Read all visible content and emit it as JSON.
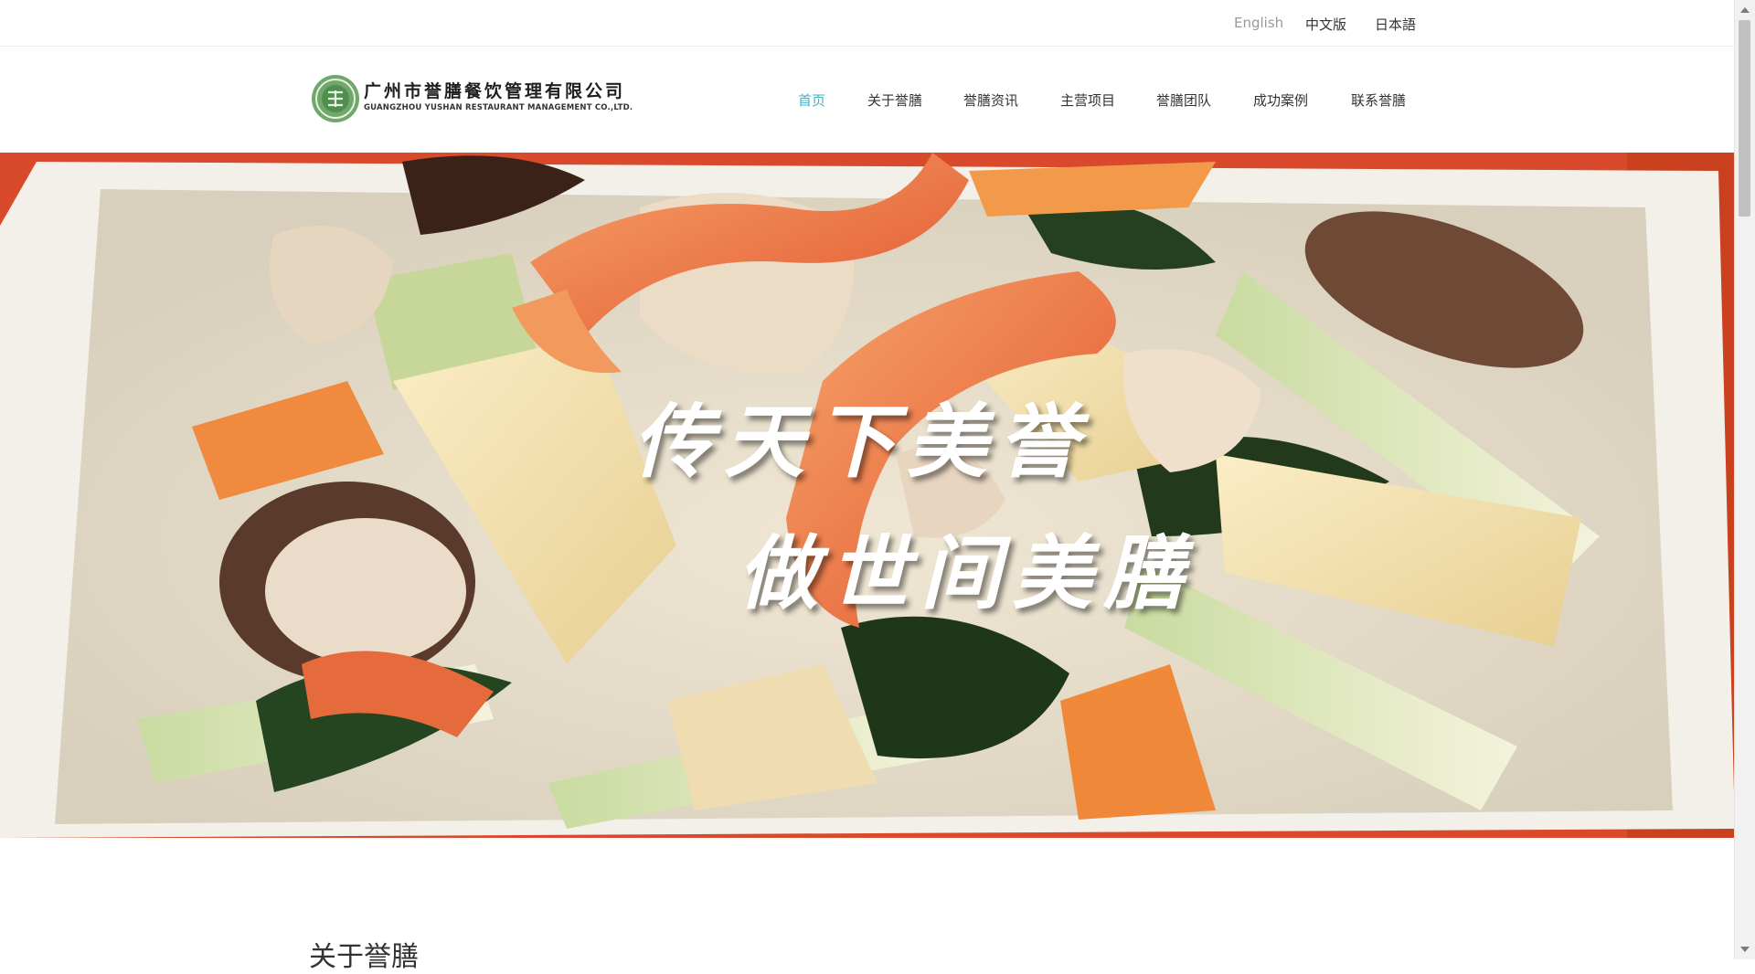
{
  "languages": {
    "english": "English",
    "chinese": "中文版",
    "japanese": "日本語"
  },
  "logo": {
    "name_cn": "广州市誉膳餐饮管理有限公司",
    "name_en": "GUANGZHOU YUSHAN RESTAURANT MANAGEMENT CO.,LTD."
  },
  "nav": {
    "items": [
      {
        "label": "首页",
        "active": true
      },
      {
        "label": "关于誉膳"
      },
      {
        "label": "誉膳资讯"
      },
      {
        "label": "主营项目"
      },
      {
        "label": "誉膳团队"
      },
      {
        "label": "成功案例"
      },
      {
        "label": "联系誉膳"
      }
    ]
  },
  "banner": {
    "slogan_line1": "传天下美誉",
    "slogan_line2": "做世间美膳"
  },
  "about": {
    "title": "关于誉膳"
  },
  "colors": {
    "accent": "#3fb3c8",
    "banner_bg": "#d9462a",
    "plate": "#f2efe9"
  }
}
